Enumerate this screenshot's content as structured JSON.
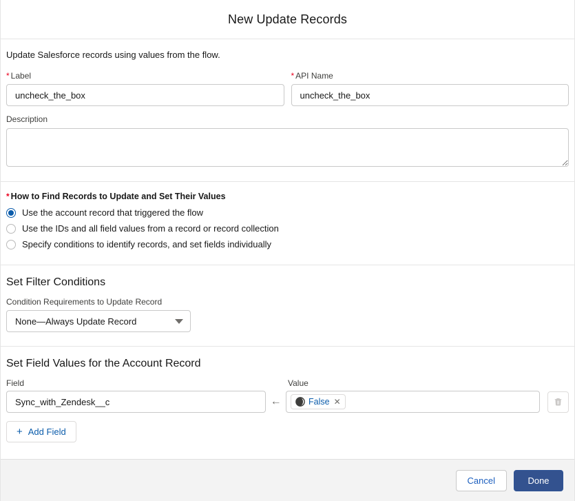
{
  "header": {
    "title": "New Update Records"
  },
  "intro": {
    "text": "Update Salesforce records using values from the flow."
  },
  "fields": {
    "label": {
      "label": "Label",
      "required": true,
      "value": "uncheck_the_box"
    },
    "api_name": {
      "label": "API Name",
      "required": true,
      "value": "uncheck_the_box"
    },
    "description": {
      "label": "Description",
      "value": "",
      "placeholder": ""
    }
  },
  "how_to_find": {
    "legend": "How to Find Records to Update and Set Their Values",
    "required": true,
    "options": [
      {
        "label": "Use the account record that triggered the flow",
        "selected": true
      },
      {
        "label": "Use the IDs and all field values from a record or record collection",
        "selected": false
      },
      {
        "label": "Specify conditions to identify records, and set fields individually",
        "selected": false
      }
    ]
  },
  "filter_section": {
    "heading": "Set Filter Conditions",
    "condition_label": "Condition Requirements to Update Record",
    "condition_value": "None—Always Update Record"
  },
  "field_values_section": {
    "heading": "Set Field Values for the Account Record",
    "field_label": "Field",
    "value_label": "Value",
    "rows": [
      {
        "field": "Sync_with_Zendesk__c",
        "arrow": "←",
        "value_pill_text": "False",
        "value_pill_remove": "✕",
        "delete_title": "Delete"
      }
    ],
    "add_field_label": "Add Field",
    "add_field_icon": "+"
  },
  "footer": {
    "cancel_label": "Cancel",
    "done_label": "Done"
  },
  "colors": {
    "accent_link": "#0b5cab",
    "required_star": "#ea001e",
    "primary_button_bg": "#33528f",
    "footer_bg": "#f3f3f3",
    "border": "#c9c9c9"
  },
  "icons": {
    "select_caret": "chevron-down-icon",
    "global_constant": "global-constant-icon",
    "trash": "trash-icon",
    "plus": "plus-icon",
    "arrow_left": "arrow-left-icon"
  }
}
